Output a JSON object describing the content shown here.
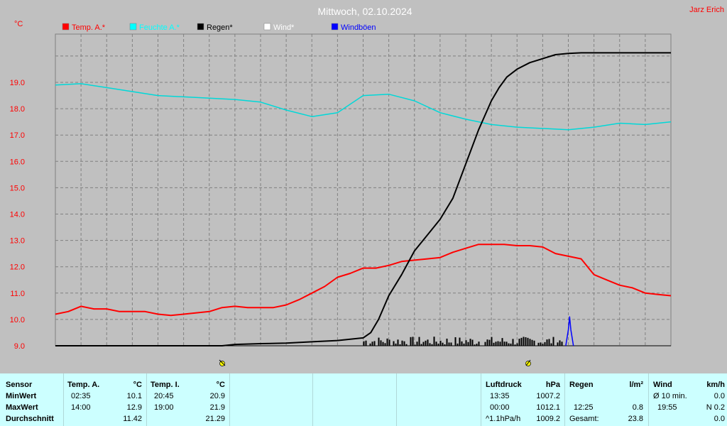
{
  "header": {
    "title": "Mittwoch, 02.10.2024",
    "author": "Jarz Erich",
    "y_unit": "°C"
  },
  "legend": [
    {
      "label": "Temp. A.*",
      "color": "#ff0000"
    },
    {
      "label": "Feuchte A.*",
      "color": "#00ffff"
    },
    {
      "label": "Regen*",
      "color": "#000000"
    },
    {
      "label": "Wind*",
      "color": "#ffffff"
    },
    {
      "label": "Windböen",
      "color": "#0000ff"
    }
  ],
  "chart_data": {
    "type": "line",
    "title": "Mittwoch, 02.10.2024",
    "ylabel": "°C",
    "ylim": [
      9.0,
      20.0
    ],
    "yticks": [
      "9.0",
      "10.0",
      "11.0",
      "12.0",
      "13.0",
      "14.0",
      "15.0",
      "16.0",
      "17.0",
      "18.0",
      "19.0"
    ],
    "xlim": [
      0,
      24
    ],
    "grid": true,
    "series": [
      {
        "name": "Temp. A.*",
        "color": "#ff0000",
        "x": [
          0,
          0.5,
          1,
          1.5,
          2,
          2.5,
          3,
          3.5,
          4,
          4.5,
          5,
          5.5,
          6,
          6.5,
          7,
          7.5,
          8,
          8.5,
          9,
          9.5,
          10,
          10.5,
          11,
          11.5,
          12,
          12.5,
          13,
          13.5,
          14,
          14.5,
          15,
          15.5,
          16,
          16.5,
          17,
          17.5,
          18,
          18.5,
          19,
          19.5,
          20,
          20.5,
          21,
          21.5,
          22,
          22.5,
          23,
          23.5,
          24
        ],
        "y": [
          10.2,
          10.3,
          10.5,
          10.4,
          10.4,
          10.3,
          10.3,
          10.3,
          10.2,
          10.15,
          10.2,
          10.25,
          10.3,
          10.45,
          10.5,
          10.45,
          10.45,
          10.45,
          10.55,
          10.75,
          11.0,
          11.25,
          11.6,
          11.75,
          11.95,
          11.95,
          12.05,
          12.2,
          12.25,
          12.3,
          12.35,
          12.55,
          12.7,
          12.85,
          12.85,
          12.85,
          12.8,
          12.8,
          12.75,
          12.5,
          12.4,
          12.3,
          11.7,
          11.5,
          11.3,
          11.2,
          11.0,
          10.95,
          10.9
        ]
      },
      {
        "name": "Feuchte A.*",
        "color": "#00d8d8",
        "x": [
          0,
          1,
          2,
          3,
          4,
          5,
          6,
          7,
          8,
          9,
          10,
          11,
          12,
          13,
          14,
          15,
          16,
          17,
          18,
          19,
          20,
          21,
          22,
          23,
          24
        ],
        "y": [
          18.9,
          18.95,
          18.8,
          18.65,
          18.5,
          18.45,
          18.4,
          18.35,
          18.25,
          17.95,
          17.7,
          17.85,
          18.5,
          18.55,
          18.3,
          17.85,
          17.6,
          17.4,
          17.3,
          17.25,
          17.2,
          17.3,
          17.45,
          17.4,
          17.5
        ]
      },
      {
        "name": "Regen*",
        "color": "#000000",
        "x": [
          0,
          6.5,
          7,
          8,
          9,
          10,
          11,
          12,
          12.3,
          12.6,
          13,
          13.5,
          14,
          14.5,
          15,
          15.5,
          16,
          16.5,
          17,
          17.3,
          17.6,
          18,
          18.5,
          19,
          19.5,
          20,
          20.5,
          21,
          24
        ],
        "y": [
          9.0,
          9.0,
          9.05,
          9.08,
          9.1,
          9.15,
          9.2,
          9.3,
          9.5,
          10.0,
          10.9,
          11.7,
          12.6,
          13.2,
          13.8,
          14.6,
          15.9,
          17.2,
          18.3,
          18.8,
          19.2,
          19.5,
          19.75,
          19.9,
          20.05,
          20.1,
          20.12,
          20.12,
          20.12
        ]
      },
      {
        "name": "Windböen",
        "color": "#0000ff",
        "x": [
          19.9,
          20.0,
          20.05,
          20.1,
          20.2
        ],
        "y": [
          9.0,
          9.6,
          10.1,
          9.6,
          9.0
        ]
      }
    ],
    "rain_bars": {
      "x_start": 12.0,
      "x_end": 19.8,
      "max": 9.35
    }
  },
  "stats": {
    "sensor_header": "Sensor",
    "row_labels": [
      "MinWert",
      "MaxWert",
      "Durchschnitt"
    ],
    "temp_a": {
      "title": "Temp. A.",
      "unit": "°C",
      "rows": [
        {
          "time": "02:35",
          "value": "10.1"
        },
        {
          "time": "14:00",
          "value": "12.9"
        },
        {
          "time": "",
          "value": "11.42"
        }
      ]
    },
    "temp_i": {
      "title": "Temp. I.",
      "unit": "°C",
      "rows": [
        {
          "time": "20:45",
          "value": "20.9"
        },
        {
          "time": "19:00",
          "value": "21.9"
        },
        {
          "time": "",
          "value": "21.29"
        }
      ]
    },
    "pressure": {
      "title": "Luftdruck",
      "unit": "hPa",
      "rows": [
        {
          "time": "13:35",
          "value": "1007.2"
        },
        {
          "time": "00:00",
          "value": "1012.1"
        },
        {
          "time": "^1.1hPa/h",
          "value": "1009.2"
        }
      ]
    },
    "rain": {
      "title": "Regen",
      "unit": "l/m²",
      "rows": [
        {
          "time": "",
          "value": ""
        },
        {
          "time": "12:25",
          "value": "0.8"
        },
        {
          "time": "Gesamt:",
          "value": "23.8"
        }
      ]
    },
    "wind": {
      "title": "Wind",
      "unit": "km/h",
      "rows": [
        {
          "time": "Ø 10 min.",
          "value": "0.0"
        },
        {
          "time": "19:55",
          "value": "N 0.2"
        },
        {
          "time": "",
          "value": "0.0"
        }
      ]
    }
  }
}
